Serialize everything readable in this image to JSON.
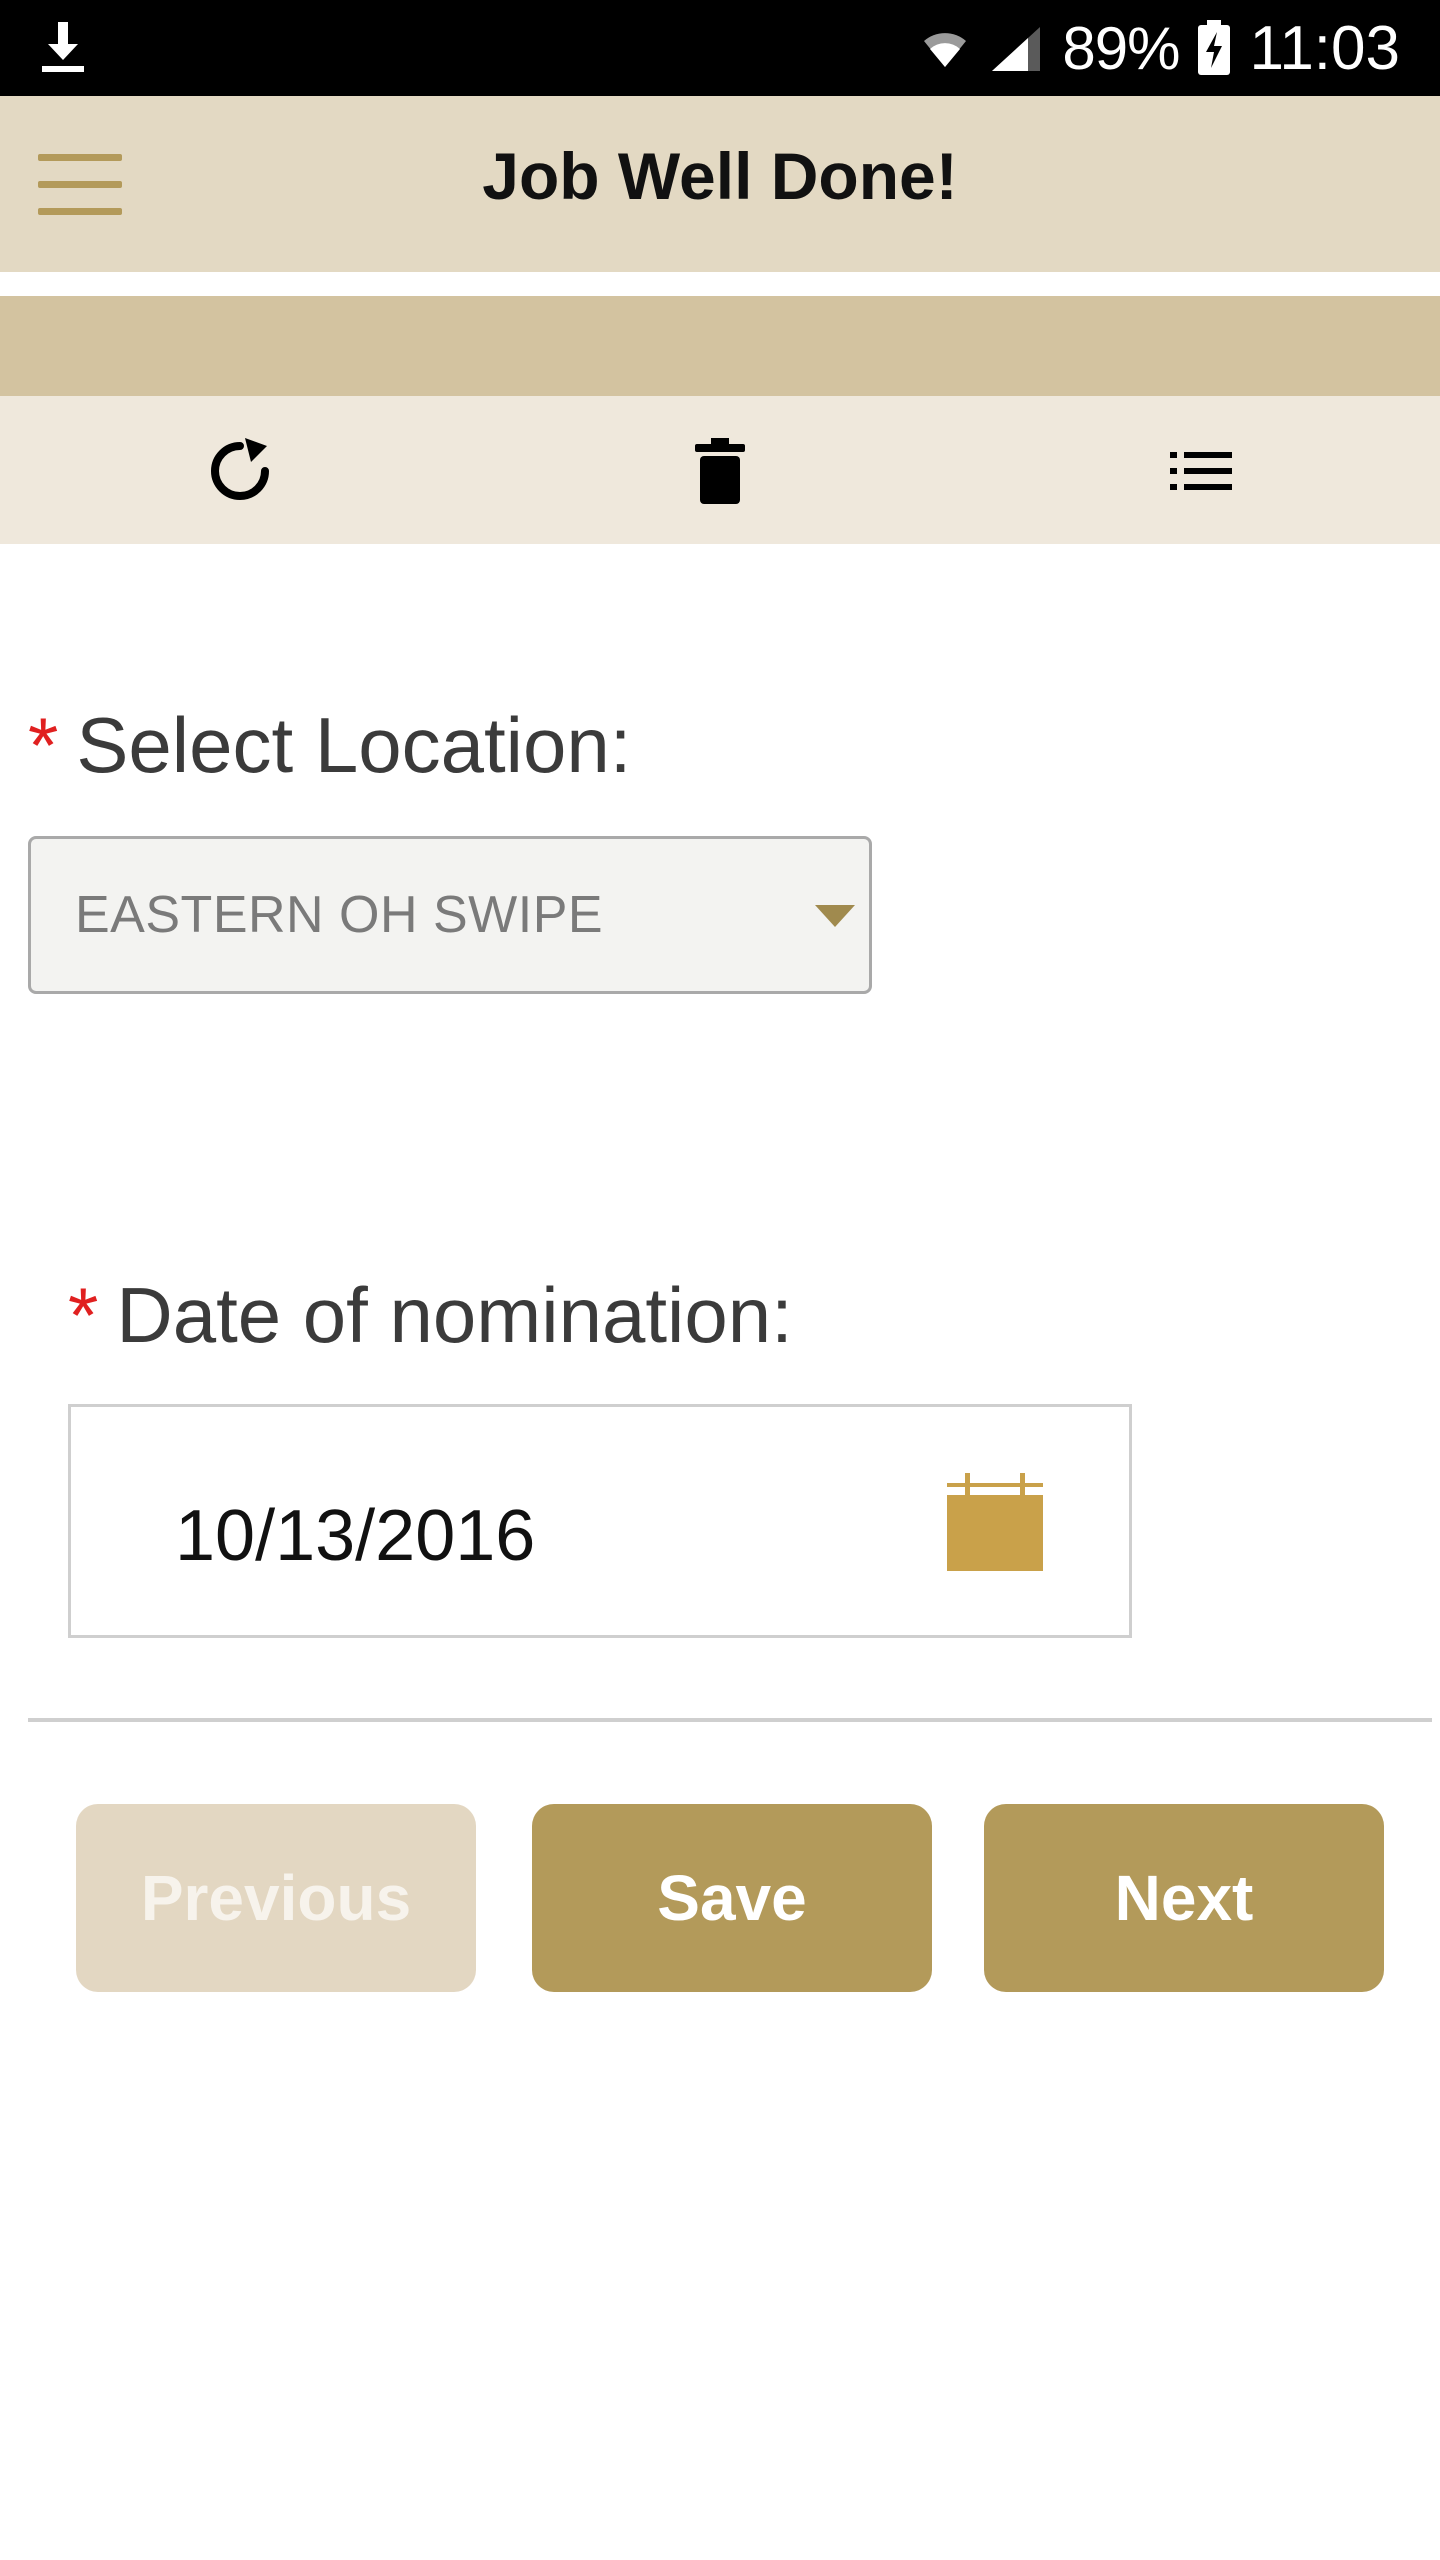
{
  "status_bar": {
    "battery_percent": "89%",
    "time": "11:03",
    "icons": [
      "download-icon",
      "wifi-icon",
      "signal-icon",
      "battery-charging-icon"
    ]
  },
  "app_bar": {
    "title": "Job Well Done!",
    "menu_icon": "hamburger-menu-icon"
  },
  "toolbar": {
    "icons": [
      "refresh-icon",
      "trash-icon",
      "list-icon"
    ]
  },
  "form": {
    "location": {
      "required_marker": "*",
      "label": "Select Location:",
      "selected_value": "EASTERN OH SWIPE"
    },
    "date": {
      "required_marker": "*",
      "label": "Date of nomination:",
      "value": "10/13/2016",
      "icon": "calendar-icon"
    }
  },
  "actions": {
    "previous_label": "Previous",
    "save_label": "Save",
    "next_label": "Next"
  },
  "colors": {
    "accent": "#b39a5a",
    "app_bar_bg": "#e3d9c3",
    "band_bg": "#d3c3a0",
    "toolbar_bg": "#efe8dc",
    "required": "#e02020",
    "disabled_button": "#e3d7c2"
  }
}
